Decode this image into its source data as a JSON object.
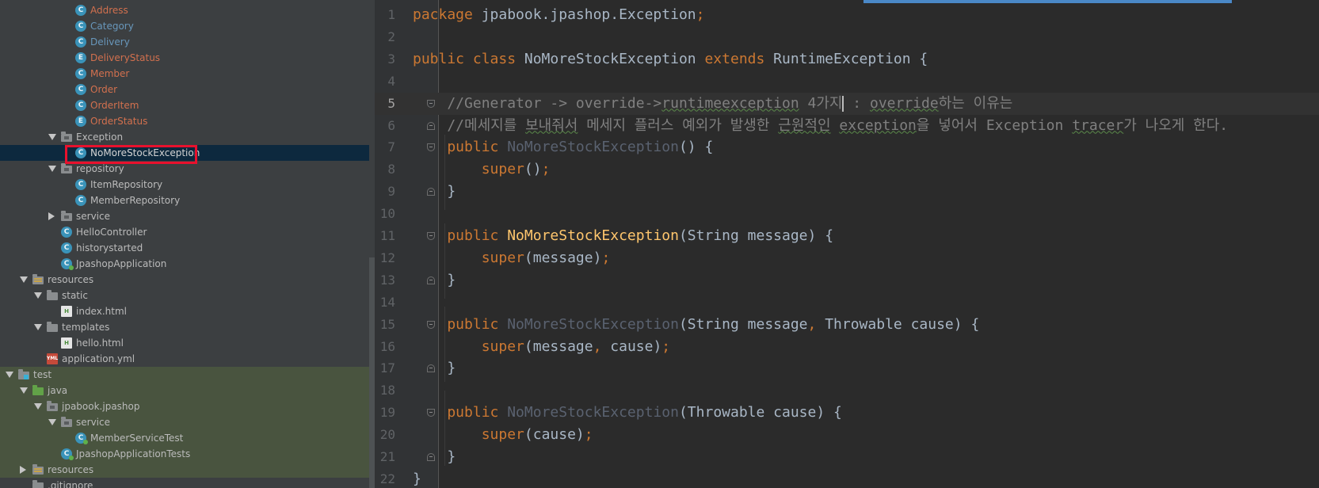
{
  "tree": {
    "rows": [
      {
        "label": "Address",
        "icon": "class",
        "style": "mod"
      },
      {
        "label": "Category",
        "icon": "class",
        "style": "blu"
      },
      {
        "label": "Delivery",
        "icon": "class",
        "style": "blu"
      },
      {
        "label": "DeliveryStatus",
        "icon": "enum",
        "style": "mod"
      },
      {
        "label": "Member",
        "icon": "class",
        "style": "mod"
      },
      {
        "label": "Order",
        "icon": "class",
        "style": "mod"
      },
      {
        "label": "OrderItem",
        "icon": "class",
        "style": "mod"
      },
      {
        "label": "OrderStatus",
        "icon": "enum",
        "style": "mod"
      },
      {
        "label": "Exception",
        "icon": "package"
      },
      {
        "label": "NoMoreStockException",
        "icon": "class",
        "selected": true
      },
      {
        "label": "repository",
        "icon": "package"
      },
      {
        "label": "ItemRepository",
        "icon": "class"
      },
      {
        "label": "MemberRepository",
        "icon": "class"
      },
      {
        "label": "service",
        "icon": "package"
      },
      {
        "label": "HelloController",
        "icon": "class"
      },
      {
        "label": "historystarted",
        "icon": "class"
      },
      {
        "label": "JpashopApplication",
        "icon": "app-class"
      },
      {
        "label": "resources",
        "icon": "resources-folder"
      },
      {
        "label": "static",
        "icon": "folder"
      },
      {
        "label": "index.html",
        "icon": "html-file"
      },
      {
        "label": "templates",
        "icon": "folder"
      },
      {
        "label": "hello.html",
        "icon": "html-file"
      },
      {
        "label": "application.yml",
        "icon": "yml-file"
      },
      {
        "label": "test",
        "icon": "test-folder"
      },
      {
        "label": "java",
        "icon": "source-folder"
      },
      {
        "label": "jpabook.jpashop",
        "icon": "package"
      },
      {
        "label": "service",
        "icon": "package"
      },
      {
        "label": "MemberServiceTest",
        "icon": "test-class"
      },
      {
        "label": "JpashopApplicationTests",
        "icon": "test-class"
      },
      {
        "label": "resources",
        "icon": "resources-folder"
      },
      {
        "label": ".gitignore",
        "icon": "file"
      }
    ],
    "class_icon_letter": "C",
    "enum_icon_letter": "E",
    "html_icon_letter": "H",
    "yml_icon_letter": "YML"
  },
  "editor": {
    "current_line": 5,
    "lines": [
      {
        "n": "1",
        "tokens": [
          [
            "kw",
            "package"
          ],
          [
            "pl",
            " jpabook.jpashop.Exception"
          ],
          [
            "kw",
            ";"
          ]
        ]
      },
      {
        "n": "2",
        "tokens": []
      },
      {
        "n": "3",
        "tokens": [
          [
            "kw",
            "public class"
          ],
          [
            "pl",
            " NoMoreStockException "
          ],
          [
            "kw",
            "extends"
          ],
          [
            "pl",
            " RuntimeException {"
          ]
        ]
      },
      {
        "n": "4",
        "tokens": []
      },
      {
        "n": "5",
        "tokens": [
          [
            "cm",
            "    //Generator -> override->"
          ],
          [
            "cmw",
            "runtimeexception"
          ],
          [
            "cm",
            " 4가지"
          ],
          [
            "caret",
            ""
          ],
          [
            "cm",
            " : "
          ],
          [
            "cmw",
            "override"
          ],
          [
            "cm",
            "하는 이유는"
          ]
        ]
      },
      {
        "n": "6",
        "tokens": [
          [
            "cm",
            "    //메세지를 "
          ],
          [
            "cmw",
            "보내줘서"
          ],
          [
            "cm",
            " 메세지 플러스 예외가 발생한 "
          ],
          [
            "cmw",
            "근원적인"
          ],
          [
            "cm",
            " "
          ],
          [
            "cmw",
            "exception"
          ],
          [
            "cm",
            "을 넣어서 Exception "
          ],
          [
            "cmw",
            "tracer"
          ],
          [
            "cm",
            "가 나오게 한다."
          ]
        ]
      },
      {
        "n": "7",
        "tokens": [
          [
            "kw",
            "    public "
          ],
          [
            "dim",
            "NoMoreStockException"
          ],
          [
            "pl",
            "() {"
          ]
        ]
      },
      {
        "n": "8",
        "tokens": [
          [
            "kw",
            "        super"
          ],
          [
            "pl",
            "()"
          ],
          [
            "kw",
            ";"
          ]
        ]
      },
      {
        "n": "9",
        "tokens": [
          [
            "pl",
            "    }"
          ]
        ]
      },
      {
        "n": "10",
        "tokens": []
      },
      {
        "n": "11",
        "tokens": [
          [
            "kw",
            "    public "
          ],
          [
            "fn",
            "NoMoreStockException"
          ],
          [
            "pl",
            "(String message) {"
          ]
        ]
      },
      {
        "n": "12",
        "tokens": [
          [
            "kw",
            "        super"
          ],
          [
            "pl",
            "(message)"
          ],
          [
            "kw",
            ";"
          ]
        ]
      },
      {
        "n": "13",
        "tokens": [
          [
            "pl",
            "    }"
          ]
        ]
      },
      {
        "n": "14",
        "tokens": []
      },
      {
        "n": "15",
        "tokens": [
          [
            "kw",
            "    public "
          ],
          [
            "dim",
            "NoMoreStockException"
          ],
          [
            "pl",
            "(String message"
          ],
          [
            "kw",
            ","
          ],
          [
            "pl",
            " Throwable cause) {"
          ]
        ]
      },
      {
        "n": "16",
        "tokens": [
          [
            "kw",
            "        super"
          ],
          [
            "pl",
            "(message"
          ],
          [
            "kw",
            ","
          ],
          [
            "pl",
            " cause)"
          ],
          [
            "kw",
            ";"
          ]
        ]
      },
      {
        "n": "17",
        "tokens": [
          [
            "pl",
            "    }"
          ]
        ]
      },
      {
        "n": "18",
        "tokens": []
      },
      {
        "n": "19",
        "tokens": [
          [
            "kw",
            "    public "
          ],
          [
            "dim",
            "NoMoreStockException"
          ],
          [
            "pl",
            "(Throwable cause) {"
          ]
        ]
      },
      {
        "n": "20",
        "tokens": [
          [
            "kw",
            "        super"
          ],
          [
            "pl",
            "(cause)"
          ],
          [
            "kw",
            ";"
          ]
        ]
      },
      {
        "n": "21",
        "tokens": [
          [
            "pl",
            "    }"
          ]
        ]
      },
      {
        "n": "22",
        "tokens": [
          [
            "pl",
            "}"
          ]
        ]
      }
    ]
  },
  "colors": {
    "tree_bg": "#3c3f41",
    "editor_bg": "#2b2b2b",
    "keyword": "#cc7832",
    "comment": "#808080",
    "method_decl": "#ffc66d",
    "highlight_box": "#e8112d",
    "selection": "#0d293e"
  }
}
